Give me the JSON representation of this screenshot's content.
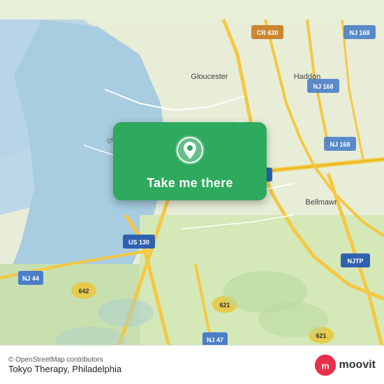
{
  "map": {
    "attribution": "© OpenStreetMap contributors",
    "location_label": "Tokyo Therapy, Philadelphia",
    "accent_color": "#2eaa5e"
  },
  "card": {
    "button_label": "Take me there"
  },
  "moovit": {
    "text": "moovit"
  }
}
